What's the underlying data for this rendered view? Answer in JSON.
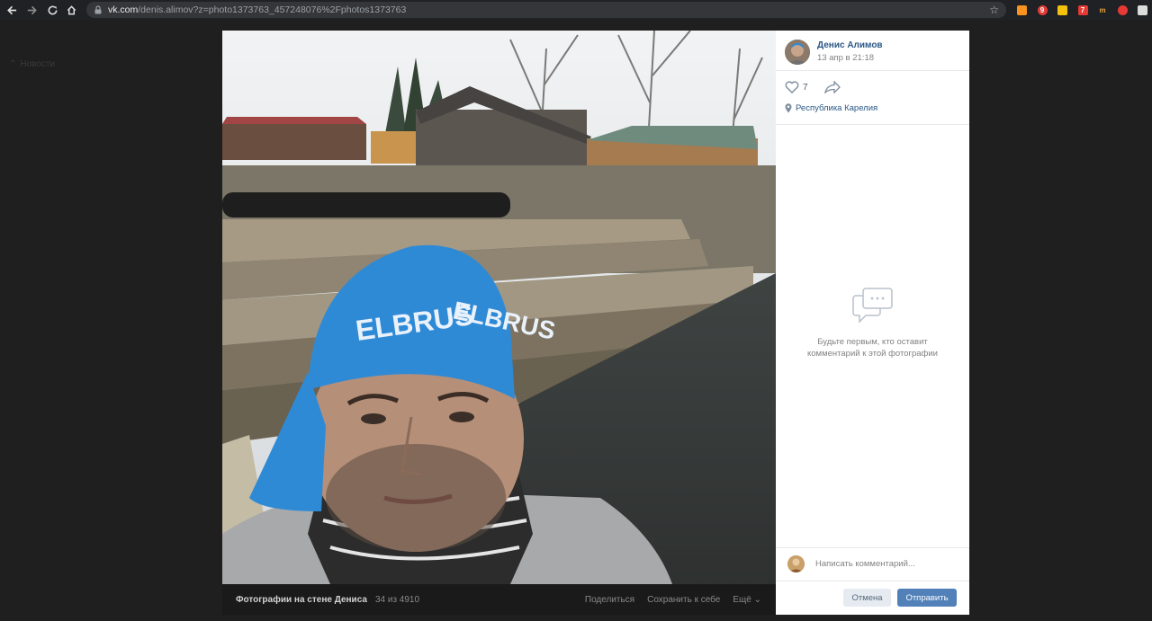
{
  "browser": {
    "url_host": "vk.com",
    "url_path": "/denis.alimov?z=photo1373763_457248076%2Fphotos1373763",
    "extensions": [
      {
        "icon": "rss-icon",
        "color": "#f7931e",
        "badge": ""
      },
      {
        "icon": "badge-icon",
        "color": "#e53935",
        "badge": "9"
      },
      {
        "icon": "flag-icon",
        "color": "#f4c20d",
        "badge": ""
      },
      {
        "icon": "puzzle-badge-icon",
        "color": "#e53935",
        "badge": "7"
      },
      {
        "icon": "m-icon",
        "color": "#e8a33c",
        "badge": "m"
      },
      {
        "icon": "download-icon",
        "color": "#e53935",
        "badge": ""
      },
      {
        "icon": "puzzle-icon",
        "color": "#dcdcdc",
        "badge": ""
      }
    ]
  },
  "background": {
    "news_label": "Новости"
  },
  "photo_bar": {
    "album": "Фотографии на стене Дениса",
    "counter": "34 из 4910",
    "share": "Поделиться",
    "save": "Сохранить к себе",
    "more": "Ещё"
  },
  "post": {
    "author": "Денис Алимов",
    "date": "13 апр в 21:18",
    "likes": "7",
    "location": "Республика Карелия"
  },
  "comments": {
    "empty_line1": "Будьте первым, кто оставит",
    "empty_line2": "комментарий к этой фотографии",
    "placeholder": "Написать комментарий...",
    "cancel": "Отмена",
    "send": "Отправить"
  },
  "colors": {
    "link": "#2a5885",
    "button": "#5181b8",
    "bandana": "#2f8ad6"
  }
}
